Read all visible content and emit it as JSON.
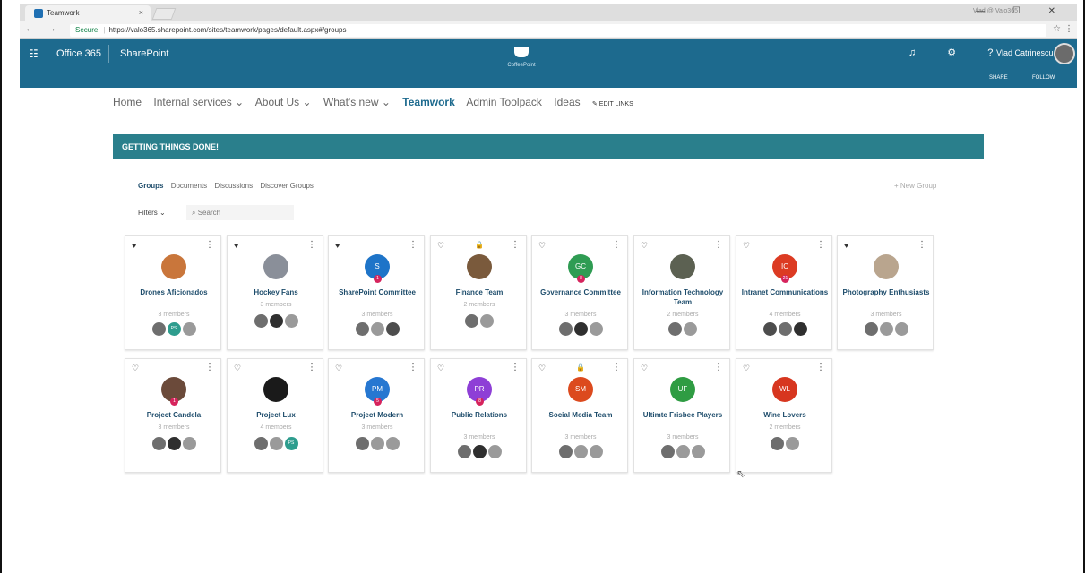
{
  "browser": {
    "tab_title": "Teamwork",
    "tab_close": "×",
    "window_user": "Vlad @ Valo365",
    "window_controls": "— ☐ ✕",
    "nav_buttons": "← → C",
    "secure_label": "Secure",
    "url": "https://valo365.sharepoint.com/sites/teamwork/pages/default.aspx#/groups",
    "star": "☆",
    "menu": "⋮"
  },
  "suitebar": {
    "waffle": "☷",
    "office": "Office 365",
    "sharepoint": "SharePoint",
    "logo_text": "CoffeePoint",
    "icons": "♫ ⚙ ?",
    "user": "Vlad Catrinescu",
    "share": "SHARE",
    "follow": "FOLLOW"
  },
  "sitenav": {
    "items": [
      "Home",
      "Internal services ⌄",
      "About Us ⌄",
      "What's new ⌄",
      "Teamwork",
      "Admin Toolpack",
      "Ideas"
    ],
    "active_index": 4,
    "edit_links": "✎ EDIT LINKS"
  },
  "banner": "GETTING THINGS DONE!",
  "groups_tabs": [
    "Groups",
    "Documents",
    "Discussions",
    "Discover Groups"
  ],
  "new_group": "+ New Group",
  "filters": "Filters ⌄",
  "search_placeholder": "Search",
  "cards": [
    {
      "name": "Drones Aficionados",
      "members": "3 members",
      "favorite": true,
      "locked": false,
      "initials": "",
      "color": "#c9763b",
      "badge": ""
    },
    {
      "name": "Hockey Fans",
      "members": "3 members",
      "favorite": true,
      "locked": false,
      "initials": "",
      "color": "#8a8f99",
      "badge": ""
    },
    {
      "name": "SharePoint Committee",
      "members": "3 members",
      "favorite": true,
      "locked": false,
      "initials": "S",
      "color": "#1e74c8",
      "badge": "1"
    },
    {
      "name": "Finance Team",
      "members": "2 members",
      "favorite": false,
      "locked": true,
      "initials": "",
      "color": "#7a5a3c",
      "badge": ""
    },
    {
      "name": "Governance Committee",
      "members": "3 members",
      "favorite": false,
      "locked": false,
      "initials": "GC",
      "color": "#2f9c53",
      "badge": "8"
    },
    {
      "name": "Information Technology Team",
      "members": "2 members",
      "favorite": false,
      "locked": false,
      "initials": "",
      "color": "#5c6152",
      "badge": ""
    },
    {
      "name": "Intranet Communications",
      "members": "4 members",
      "favorite": false,
      "locked": false,
      "initials": "IC",
      "color": "#dc3b23",
      "badge": "21"
    },
    {
      "name": "Photography Enthusiasts",
      "members": "3 members",
      "favorite": true,
      "locked": false,
      "initials": "",
      "color": "#b9a58e",
      "badge": ""
    },
    {
      "name": "Project Candela",
      "members": "3 members",
      "favorite": false,
      "locked": false,
      "initials": "",
      "color": "#6b4a3a",
      "badge": "1"
    },
    {
      "name": "Project Lux",
      "members": "4 members",
      "favorite": false,
      "locked": false,
      "initials": "",
      "color": "#1a1a1a",
      "badge": ""
    },
    {
      "name": "Project Modern",
      "members": "3 members",
      "favorite": false,
      "locked": false,
      "initials": "PM",
      "color": "#2677d1",
      "badge": "5"
    },
    {
      "name": "Public Relations",
      "members": "3 members",
      "favorite": false,
      "locked": false,
      "initials": "PR",
      "color": "#8e3fd6",
      "badge": "8"
    },
    {
      "name": "Social Media Team",
      "members": "3 members",
      "favorite": false,
      "locked": true,
      "initials": "SM",
      "color": "#dc4a1e",
      "badge": ""
    },
    {
      "name": "Ultimte Frisbee Players",
      "members": "3 members",
      "favorite": false,
      "locked": false,
      "initials": "UF",
      "color": "#2f9c43",
      "badge": ""
    },
    {
      "name": "Wine Lovers",
      "members": "2 members",
      "favorite": false,
      "locked": false,
      "initials": "WL",
      "color": "#d7361f",
      "badge": ""
    }
  ],
  "card_people": [
    [
      "p-a",
      "p-ps:PS",
      "p-c"
    ],
    [
      "p-a",
      "p-b",
      "p-c"
    ],
    [
      "p-a",
      "p-c",
      "p-d"
    ],
    [
      "p-a",
      "p-c"
    ],
    [
      "p-a",
      "p-b",
      "p-c"
    ],
    [
      "p-a",
      "p-c"
    ],
    [
      "p-d",
      "p-a",
      "p-b"
    ],
    [
      "p-a",
      "p-c",
      "p-c"
    ],
    [
      "p-a",
      "p-b",
      "p-c"
    ],
    [
      "p-a",
      "p-c",
      "p-ps:PS"
    ],
    [
      "p-a",
      "p-c",
      "p-c"
    ],
    [
      "p-a",
      "p-b",
      "p-c"
    ],
    [
      "p-a",
      "p-c",
      "p-c"
    ],
    [
      "p-a",
      "p-c",
      "p-c"
    ],
    [
      "p-a",
      "p-c"
    ]
  ]
}
